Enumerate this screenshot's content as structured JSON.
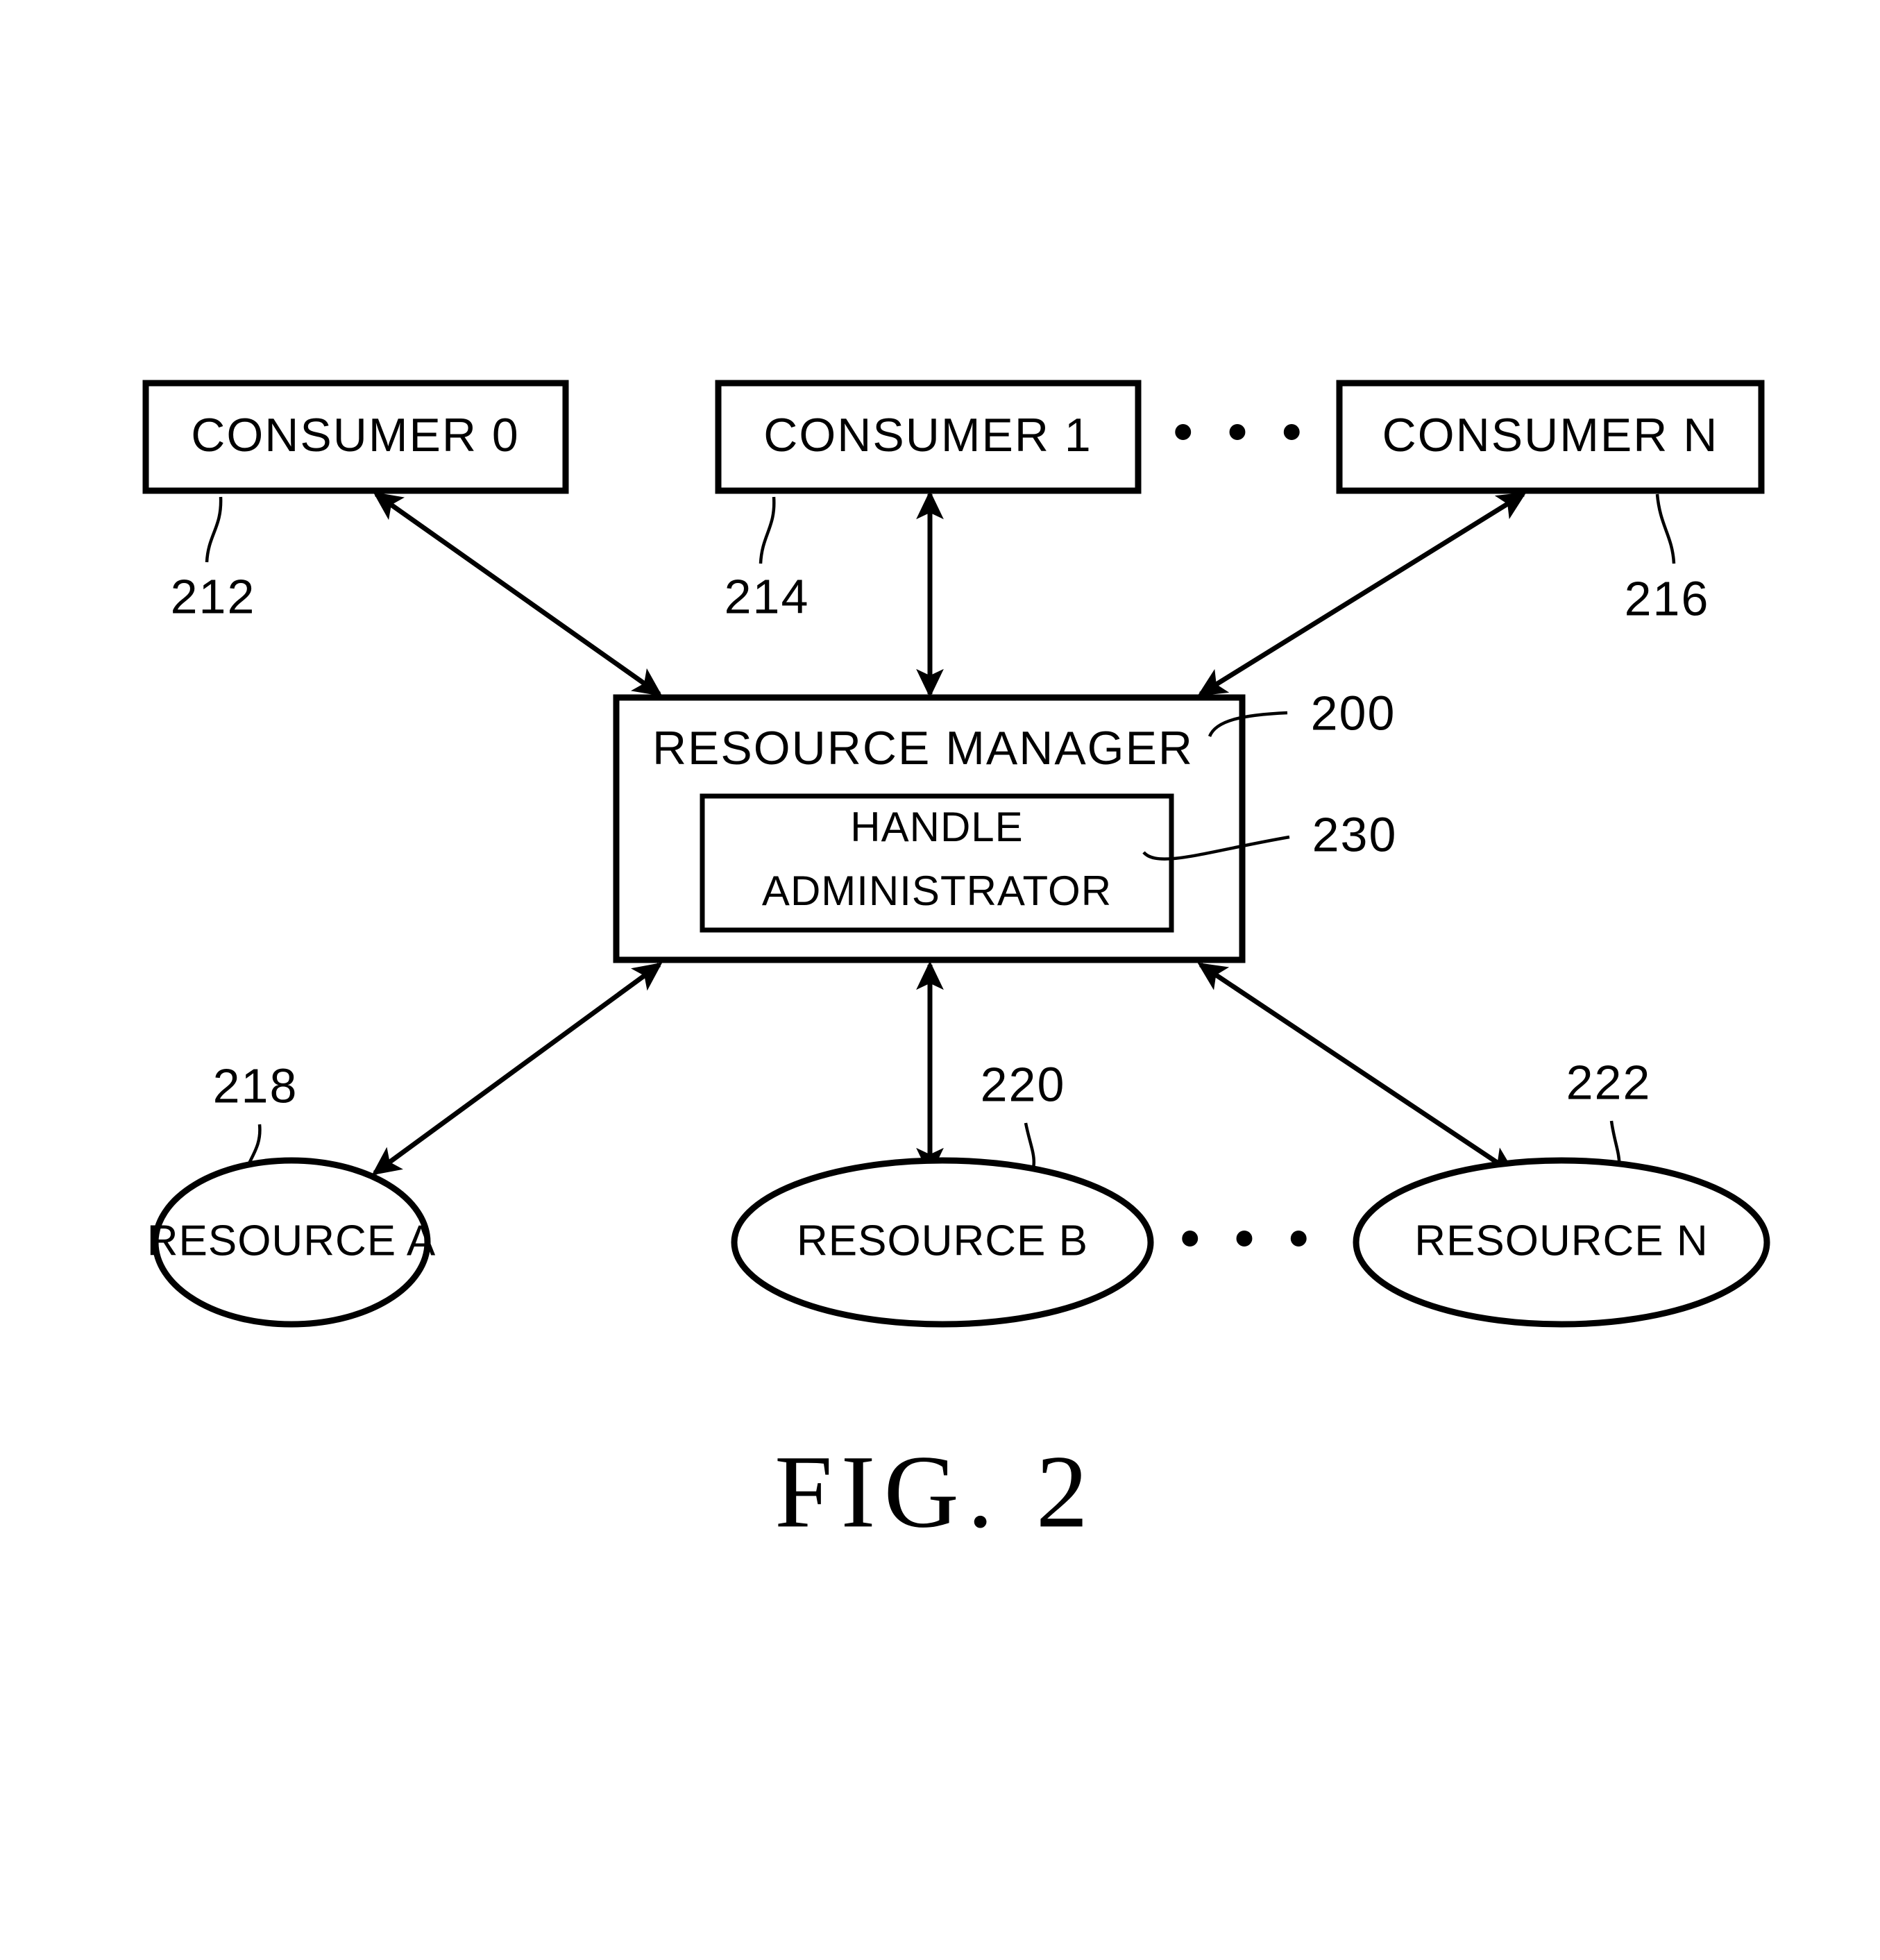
{
  "figure": {
    "caption": "FIG.  2"
  },
  "consumers": [
    {
      "label": "CONSUMER  0",
      "ref": "212"
    },
    {
      "label": "CONSUMER  1",
      "ref": "214"
    },
    {
      "label": "CONSUMER  N",
      "ref": "216"
    }
  ],
  "consumer_ellipsis": "• • •",
  "manager": {
    "label": "RESOURCE  MANAGER",
    "ref": "200",
    "inner": {
      "line1": "HANDLE",
      "line2": "ADMINISTRATOR",
      "ref": "230"
    }
  },
  "resources": [
    {
      "label": "RESOURCE  A",
      "ref": "218"
    },
    {
      "label": "RESOURCE  B",
      "ref": "220"
    },
    {
      "label": "RESOURCE  N",
      "ref": "222"
    }
  ],
  "resource_ellipsis": "• • •",
  "colors": {
    "ink": "#000000",
    "paper": "#ffffff"
  }
}
